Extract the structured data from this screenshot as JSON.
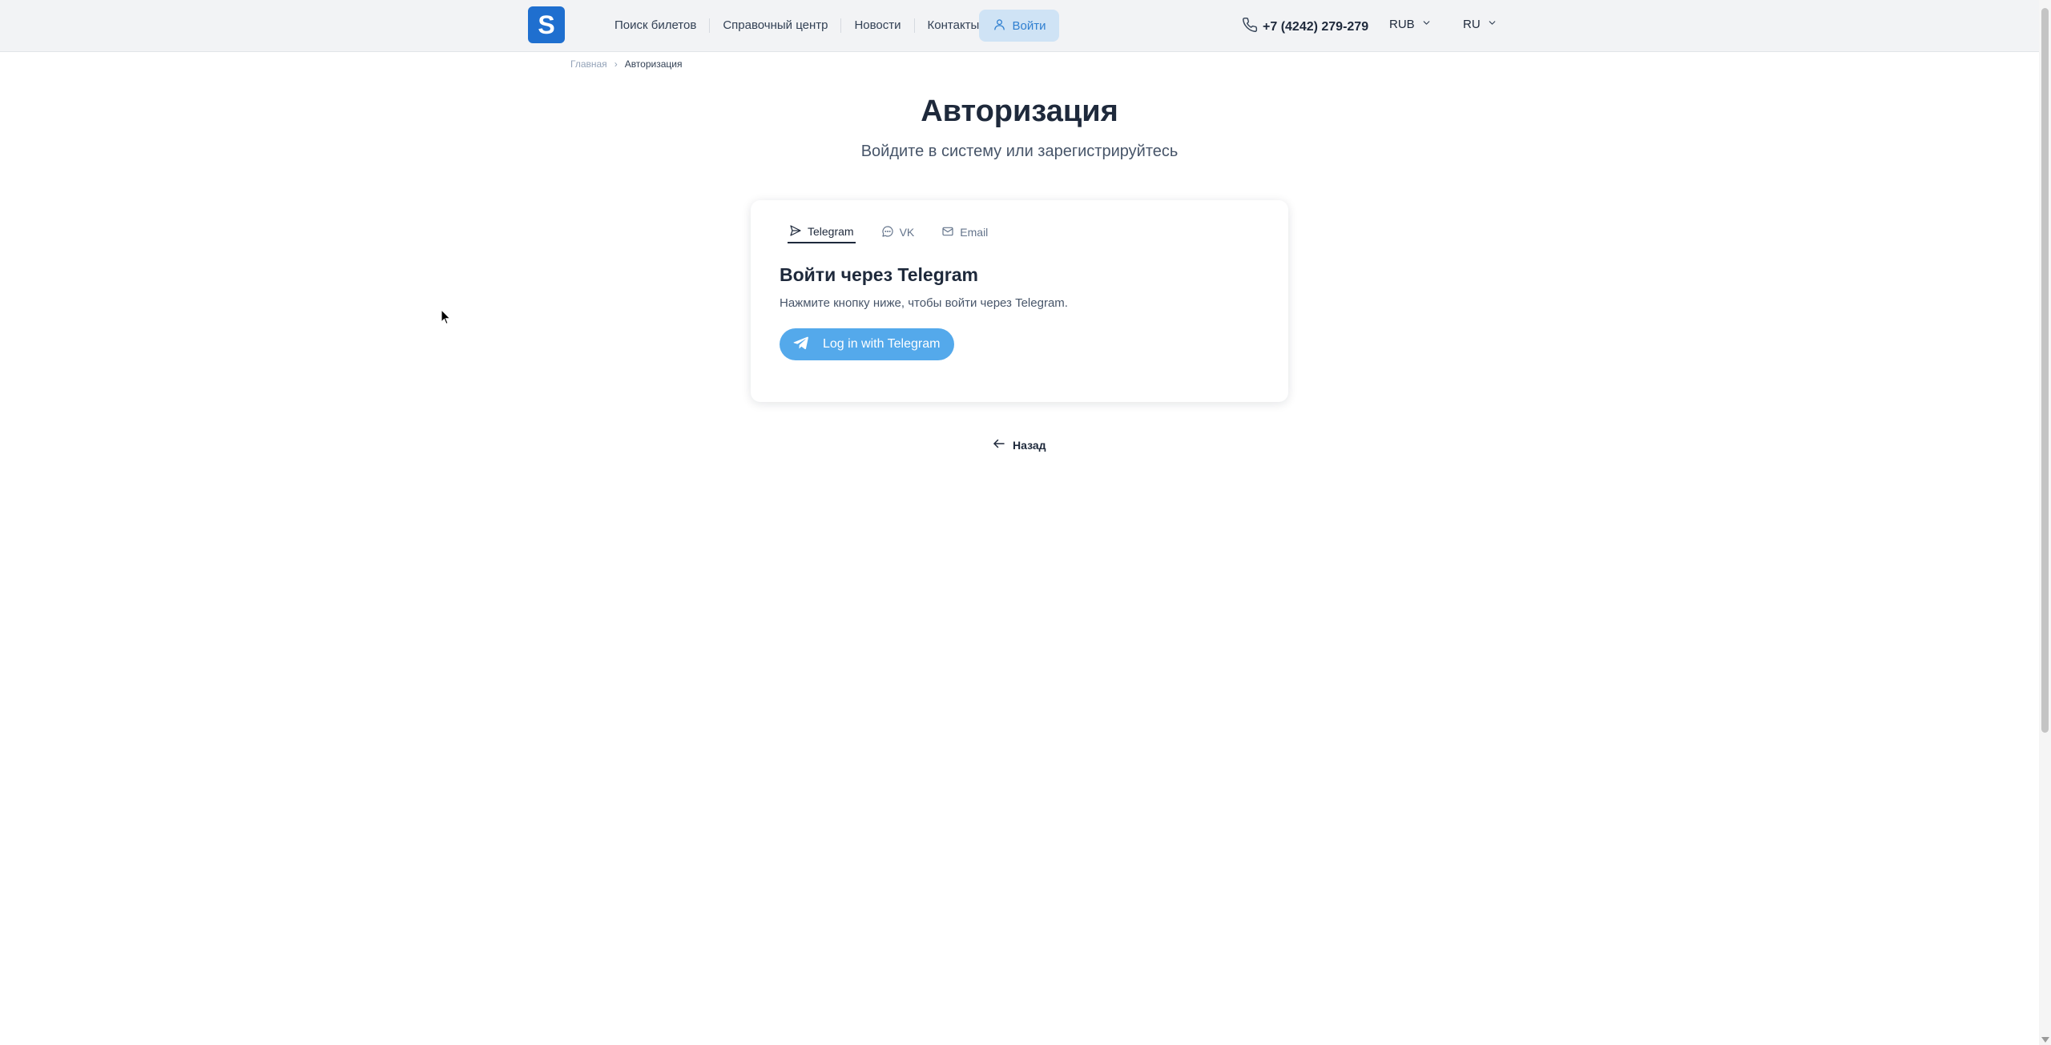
{
  "header": {
    "logo_letter": "S",
    "nav": [
      "Поиск билетов",
      "Справочный центр",
      "Новости",
      "Контакты"
    ],
    "login_label": "Войти",
    "phone": "+7 (4242) 279-279",
    "currency": "RUB",
    "language": "RU"
  },
  "breadcrumb": {
    "home": "Главная",
    "current": "Авторизация"
  },
  "page": {
    "title": "Авторизация",
    "subtitle": "Войдите в систему или зарегистрируйтесь"
  },
  "card": {
    "tabs": [
      "Telegram",
      "VK",
      "Email"
    ],
    "active_tab": "Telegram",
    "heading": "Войти через Telegram",
    "text": "Нажмите кнопку ниже, чтобы войти через Telegram.",
    "telegram_button": "Log in with Telegram"
  },
  "back_label": "Назад",
  "colors": {
    "brand": "#1f6fcf",
    "telegram": "#54a9eb",
    "login_bg": "#cfe3f5"
  },
  "icons": [
    "user-icon",
    "phone-icon",
    "chevron-down-icon",
    "send-icon",
    "chat-bubble-icon",
    "mail-icon",
    "telegram-plane-icon",
    "arrow-left-icon"
  ]
}
